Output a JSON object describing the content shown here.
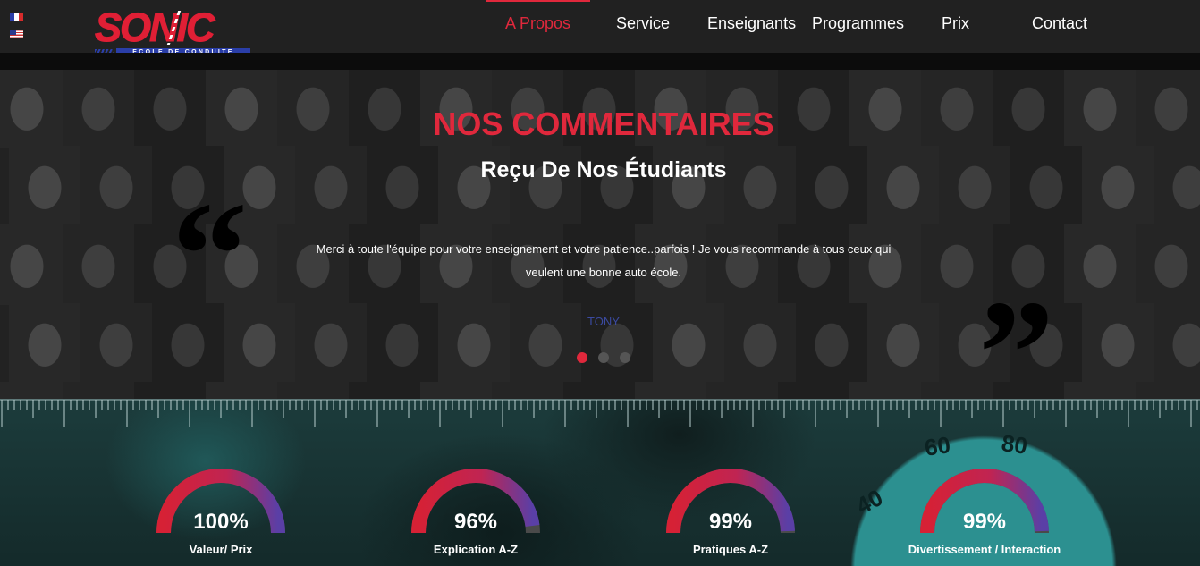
{
  "header": {
    "languages": [
      "fr-flag-icon",
      "us-flag-icon"
    ],
    "logo": {
      "name": "SONIC",
      "tagline": "ECOLE DE CONDUITE"
    },
    "nav": [
      {
        "label": "A Propos",
        "active": true
      },
      {
        "label": "Service"
      },
      {
        "label": "Enseignants"
      },
      {
        "label": "Programmes"
      },
      {
        "label": "Prix"
      },
      {
        "label": "Contact"
      }
    ]
  },
  "testimonials": {
    "title": "NOS COMMENTAIRES",
    "subtitle": "Reçu De Nos Étudiants",
    "quote": "Merci à toute l'équipe pour votre enseignement et votre patience..parfois ! Je vous recommande à tous ceux qui veulent une bonne auto école.",
    "author": "TONY",
    "slides": 3,
    "active_slide": 1
  },
  "stats": {
    "items": [
      {
        "value": "100%",
        "label": "Valeur/ Prix",
        "percent": 100
      },
      {
        "value": "96%",
        "label": "Explication A-Z",
        "percent": 96
      },
      {
        "value": "99%",
        "label": "Pratiques A-Z",
        "percent": 99
      },
      {
        "value": "99%",
        "label": "Divertissement / Interaction",
        "percent": 99
      }
    ],
    "background_numbers": [
      "60",
      "80",
      "40"
    ]
  },
  "colors": {
    "accent": "#e0283c",
    "gauge_start": "#d62135",
    "gauge_end": "#5a3fa6",
    "gauge_track": "#4a4a4a",
    "author": "#3b4aa0"
  }
}
